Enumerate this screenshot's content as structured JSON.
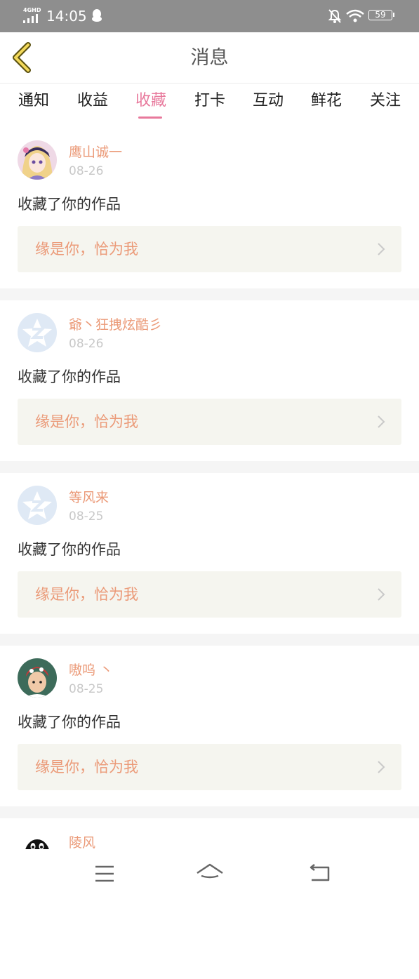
{
  "status_bar": {
    "network": "4GHD",
    "time": "14:05",
    "battery": "59"
  },
  "nav": {
    "title": "消息"
  },
  "tabs": [
    {
      "label": "通知"
    },
    {
      "label": "收益"
    },
    {
      "label": "收藏",
      "active": true
    },
    {
      "label": "打卡"
    },
    {
      "label": "互动"
    },
    {
      "label": "鲜花"
    },
    {
      "label": "关注"
    }
  ],
  "messages": [
    {
      "username": "鹰山诚一",
      "date": "08-26",
      "action": "收藏了你的作品",
      "work_title": "缘是你，恰为我",
      "avatar": "anime-avatar"
    },
    {
      "username": "爺丶狂拽炫酷彡",
      "date": "08-26",
      "action": "收藏了你的作品",
      "work_title": "缘是你，恰为我",
      "avatar": "default-star-avatar"
    },
    {
      "username": "等风来",
      "date": "08-25",
      "action": "收藏了你的作品",
      "work_title": "缘是你，恰为我",
      "avatar": "default-star-avatar"
    },
    {
      "username": "嗷呜 丶",
      "date": "08-25",
      "action": "收藏了你的作品",
      "work_title": "缘是你，恰为我",
      "avatar": "photo-avatar"
    },
    {
      "username": "陵风",
      "avatar": "penguin-avatar"
    }
  ],
  "colors": {
    "accent": "#e8799c",
    "username": "#eb9a78",
    "status_bar": "#8e8e8e",
    "work_box_bg": "#f5f5ef"
  }
}
